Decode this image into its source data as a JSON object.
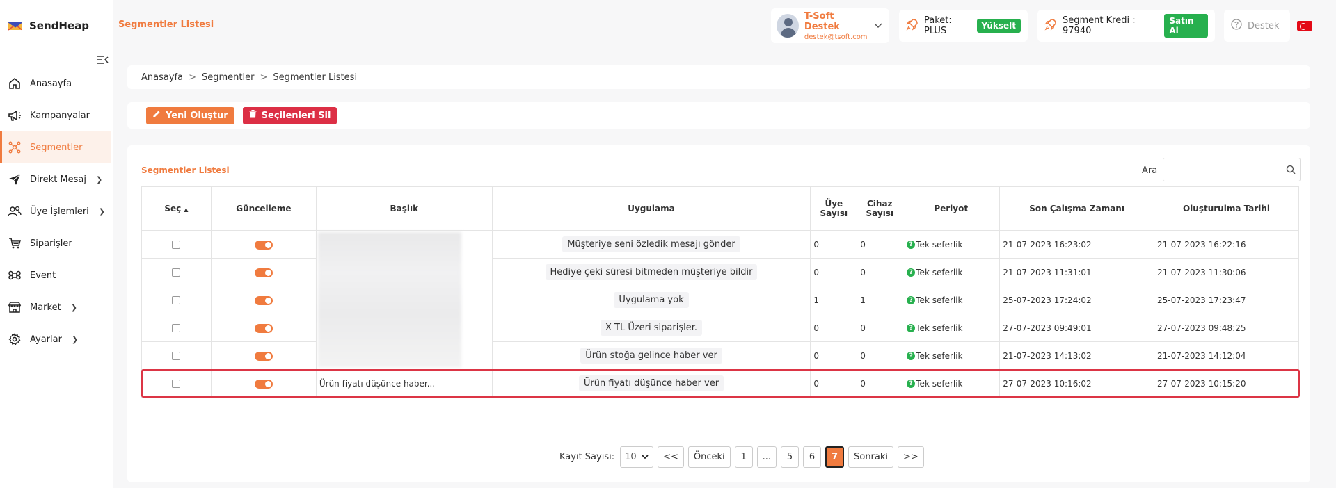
{
  "app": {
    "name": "SendHeap"
  },
  "header": {
    "page_title": "Segmentler Listesi",
    "user": {
      "name": "T-Soft Destek",
      "email": "destek@tsoft.com"
    },
    "package": {
      "label": "Paket: PLUS",
      "action": "Yükselt"
    },
    "credit": {
      "label": "Segment Kredi : 97940",
      "action": "Satın Al"
    },
    "support": "Destek"
  },
  "sidebar": {
    "items": [
      {
        "label": "Anasayfa",
        "icon": "home-icon"
      },
      {
        "label": "Kampanyalar",
        "icon": "megaphone-icon"
      },
      {
        "label": "Segmentler",
        "icon": "segment-icon",
        "active": true
      },
      {
        "label": "Direkt Mesaj",
        "icon": "send-icon",
        "chevron": true
      },
      {
        "label": "Üye İşlemleri",
        "icon": "users-icon",
        "chevron": true
      },
      {
        "label": "Siparişler",
        "icon": "cart-icon"
      },
      {
        "label": "Event",
        "icon": "command-icon"
      },
      {
        "label": "Market",
        "icon": "store-icon",
        "chevron": true
      },
      {
        "label": "Ayarlar",
        "icon": "gear-icon",
        "chevron": true
      }
    ]
  },
  "breadcrumb": [
    "Anasayfa",
    "Segmentler",
    "Segmentler Listesi"
  ],
  "actions": {
    "create": "Yeni Oluştur",
    "delete": "Seçilenleri Sil"
  },
  "list": {
    "title": "Segmentler Listesi",
    "search_label": "Ara",
    "search_value": "",
    "columns": [
      "Seç",
      "Güncelleme",
      "Başlık",
      "Uygulama",
      "Üye Sayısı",
      "Cihaz Sayısı",
      "Periyot",
      "Son Çalışma Zamanı",
      "Oluşturulma Tarihi"
    ],
    "rows": [
      {
        "title": "",
        "app": "Müşteriye seni özledik mesajı gönder",
        "members": "0",
        "devices": "0",
        "period": "Tek seferlik",
        "last_run": "21-07-2023 16:23:02",
        "created": "21-07-2023 16:22:16"
      },
      {
        "title": "",
        "app": "Hediye çeki süresi bitmeden müşteriye bildir",
        "members": "0",
        "devices": "0",
        "period": "Tek seferlik",
        "last_run": "21-07-2023 11:31:01",
        "created": "21-07-2023 11:30:06"
      },
      {
        "title": "",
        "app": "Uygulama yok",
        "members": "1",
        "devices": "1",
        "period": "Tek seferlik",
        "last_run": "25-07-2023 17:24:02",
        "created": "25-07-2023 17:23:47"
      },
      {
        "title": "",
        "app": "X TL Üzeri siparişler.",
        "members": "0",
        "devices": "0",
        "period": "Tek seferlik",
        "last_run": "27-07-2023 09:49:01",
        "created": "27-07-2023 09:48:25"
      },
      {
        "title": "",
        "app": "Ürün stoğa gelince haber ver",
        "members": "0",
        "devices": "0",
        "period": "Tek seferlik",
        "last_run": "21-07-2023 14:13:02",
        "created": "21-07-2023 14:12:04"
      },
      {
        "title": "Ürün fiyatı düşünce haber...",
        "app": "Ürün fiyatı düşünce haber ver",
        "members": "0",
        "devices": "0",
        "period": "Tek seferlik",
        "last_run": "27-07-2023 10:16:02",
        "created": "27-07-2023 10:15:20"
      }
    ]
  },
  "pagination": {
    "label": "Kayıt Sayısı:",
    "page_size": "10",
    "first": "<<",
    "prev": "Önceki",
    "pages": [
      "1",
      "...",
      "5",
      "6",
      "7"
    ],
    "current": "7",
    "next": "Sonraki",
    "last": ">>"
  },
  "colors": {
    "accent": "#f07b3f",
    "danger": "#dc2f45",
    "success": "#27b04e"
  }
}
